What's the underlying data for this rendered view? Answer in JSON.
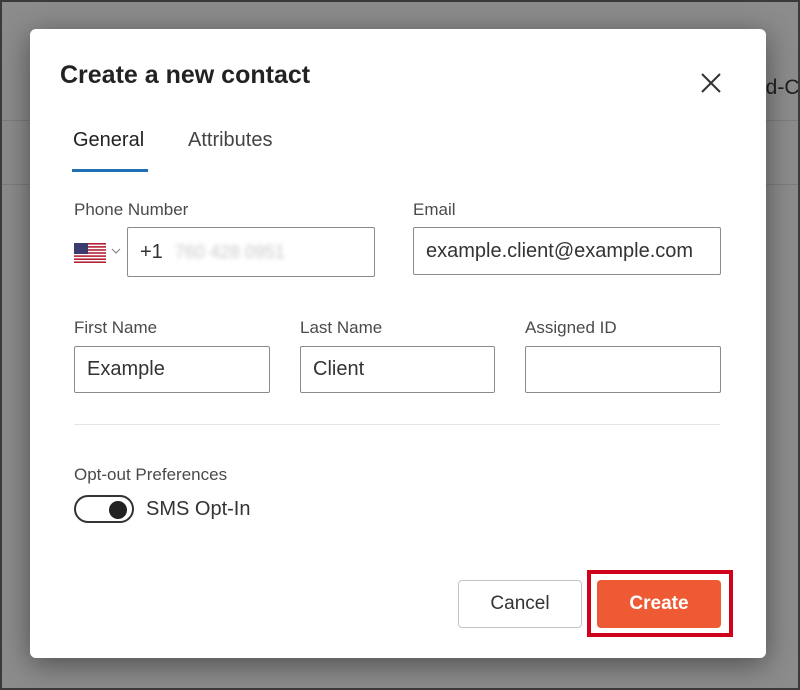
{
  "background": {
    "partial_text": "ed-C"
  },
  "modal": {
    "title": "Create a new contact",
    "tabs": [
      {
        "label": "General",
        "active": true
      },
      {
        "label": "Attributes",
        "active": false
      }
    ],
    "phone": {
      "label": "Phone Number",
      "country_flag": "us-flag-icon",
      "country_code": "+1",
      "number_obscured": "760 428 0951"
    },
    "email": {
      "label": "Email",
      "value": "example.client@example.com"
    },
    "first_name": {
      "label": "First Name",
      "value": "Example"
    },
    "last_name": {
      "label": "Last Name",
      "value": "Client"
    },
    "assigned_id": {
      "label": "Assigned ID",
      "value": ""
    },
    "opt_out": {
      "label": "Opt-out Preferences",
      "toggle_label": "SMS Opt-In",
      "enabled": true
    },
    "buttons": {
      "cancel": "Cancel",
      "create": "Create"
    }
  },
  "colors": {
    "accent_tab": "#1f6fb5",
    "create_button": "#ee5a33",
    "highlight": "#d0021b"
  }
}
